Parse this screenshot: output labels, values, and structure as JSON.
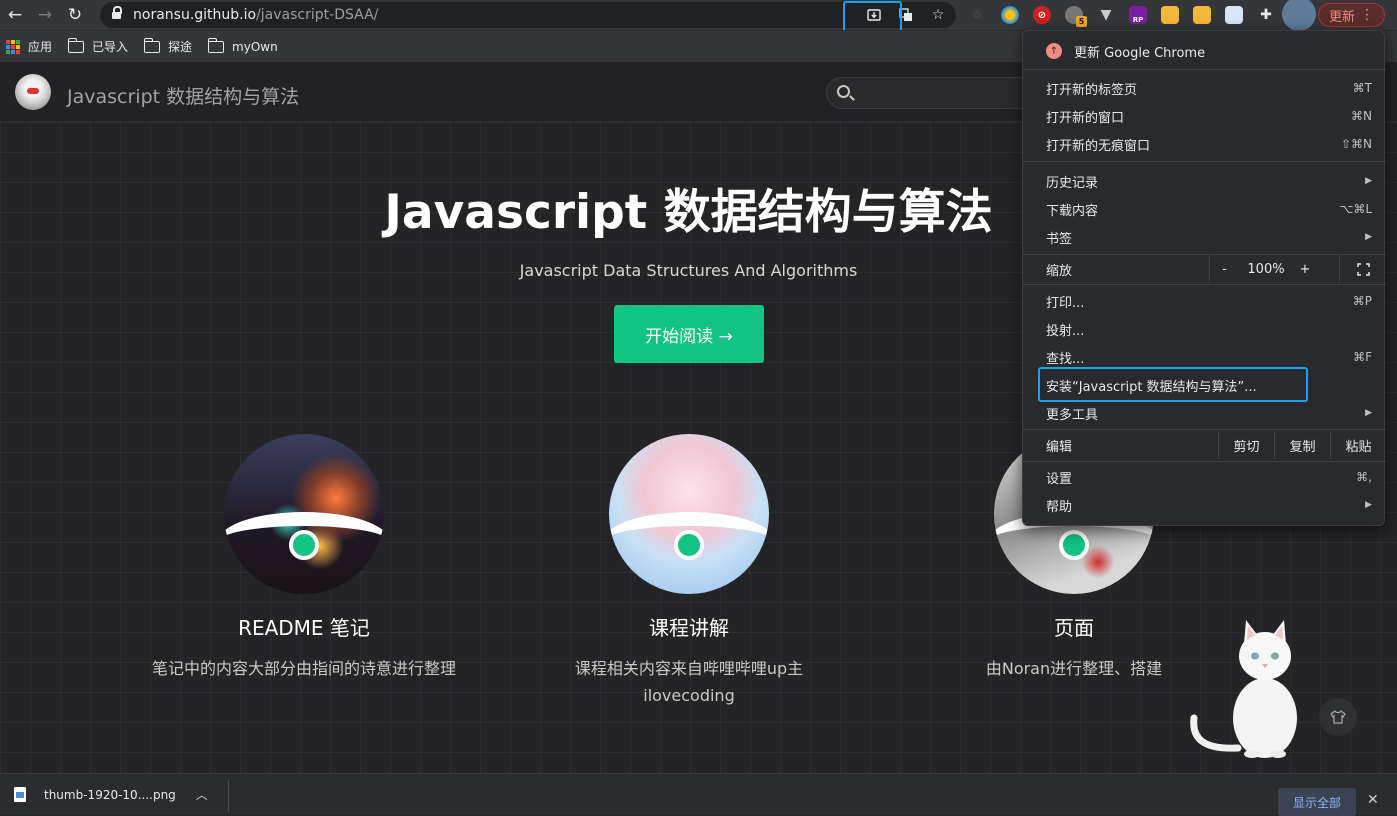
{
  "browser": {
    "url_host": "noransu.github.io",
    "url_path": "/javascript-DSAA/",
    "update_label": "更新",
    "extension_badge": "5",
    "extension_rp": "RP"
  },
  "bookmarks": [
    {
      "label": "应用",
      "icon": "apps-grid-icon"
    },
    {
      "label": "已导入",
      "icon": "folder-icon"
    },
    {
      "label": "探途",
      "icon": "folder-icon"
    },
    {
      "label": "myOwn",
      "icon": "folder-icon"
    }
  ],
  "site": {
    "nav_title": "Javascript 数据结构与算法",
    "hero_title": "Javascript 数据结构与算法",
    "hero_subtitle": "Javascript Data Structures And Algorithms",
    "cta_label": "开始阅读 →",
    "features": [
      {
        "title": "README 笔记",
        "desc": "笔记中的内容大部分由指间的诗意进行整理"
      },
      {
        "title": "课程讲解",
        "desc": "课程相关内容来自哔哩哔哩up主 ilovecoding"
      },
      {
        "title": "页面",
        "desc": "由Noran进行整理、搭建"
      }
    ]
  },
  "menu": {
    "update": "更新 Google Chrome",
    "new_tab": "打开新的标签页",
    "new_tab_sc": "⌘T",
    "new_window": "打开新的窗口",
    "new_window_sc": "⌘N",
    "incognito": "打开新的无痕窗口",
    "incognito_sc": "⇧⌘N",
    "history": "历史记录",
    "downloads": "下载内容",
    "downloads_sc": "⌥⌘L",
    "bookmarks": "书签",
    "zoom": "缩放",
    "zoom_minus": "-",
    "zoom_value": "100%",
    "zoom_plus": "+",
    "print": "打印...",
    "print_sc": "⌘P",
    "cast": "投射...",
    "find": "查找...",
    "find_sc": "⌘F",
    "install": "安装“Javascript 数据结构与算法”...",
    "more_tools": "更多工具",
    "edit": "编辑",
    "cut": "剪切",
    "copy": "复制",
    "paste": "粘贴",
    "settings": "设置",
    "settings_sc": "⌘,",
    "help": "帮助"
  },
  "download": {
    "filename": "thumb-1920-10....png",
    "show_all": "显示全部"
  },
  "colors": {
    "accent": "#11c481",
    "highlight": "#1da1f2"
  }
}
